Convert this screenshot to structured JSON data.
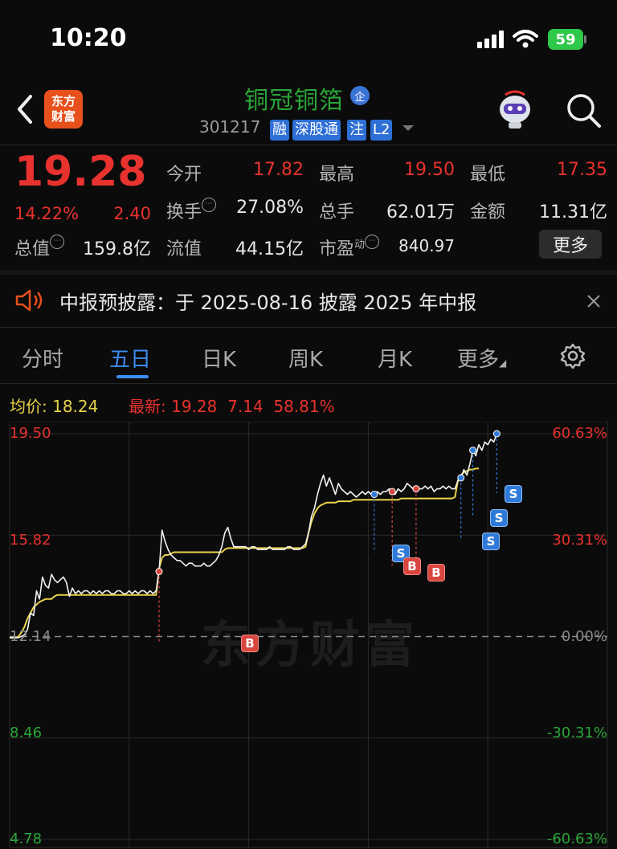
{
  "status_bar": {
    "time": "10:20",
    "battery": "59"
  },
  "header": {
    "logo_line1": "东方",
    "logo_line2": "财富",
    "title": "铜冠铜箔",
    "title_badge": "企",
    "code": "301217",
    "tags": [
      "融",
      "深股通",
      "注",
      "L2"
    ]
  },
  "quote": {
    "price": "19.28",
    "change_pct": "14.22%",
    "change_amt": "2.40",
    "open_label": "今开",
    "open_value": "17.82",
    "high_label": "最高",
    "high_value": "19.50",
    "low_label": "最低",
    "low_value": "17.35",
    "turnover_label": "换手",
    "turnover_value": "27.08%",
    "volume_label": "总手",
    "volume_value": "62.01万",
    "amount_label": "金额",
    "amount_value": "11.31亿",
    "mcap_label": "总值",
    "mcap_value": "159.8亿",
    "float_label": "流值",
    "float_value": "44.15亿",
    "pe_label": "市盈",
    "pe_sup": "动",
    "pe_value": "840.97",
    "more_label": "更多"
  },
  "notice": {
    "text": "中报预披露：于 2025-08-16 披露 2025 年中报"
  },
  "tabs": [
    "分时",
    "五日",
    "日K",
    "周K",
    "月K",
    "更多"
  ],
  "active_tab": "五日",
  "chart_header": {
    "avg_label": "均价:",
    "avg_value": "18.24",
    "latest_label": "最新:",
    "latest_value": "19.28",
    "latest_change": "7.14",
    "latest_pct": "58.81%"
  },
  "watermark": "东方财富",
  "colors": {
    "up": "#e8322e",
    "down": "#2aa637",
    "accent": "#3d8df0",
    "avg_line": "#e8d24a"
  },
  "chart_data": {
    "type": "line",
    "y_left_ticks": [
      "19.50",
      "15.82",
      "12.14",
      "8.46",
      "4.78"
    ],
    "y_right_ticks": [
      "60.63%",
      "30.31%",
      "0.00%",
      "-30.31%",
      "-60.63%"
    ],
    "ylim": [
      4.78,
      19.5
    ],
    "reference_price": 12.14,
    "days": 5,
    "series": [
      {
        "name": "价格",
        "values": [
          12.1,
          12.1,
          12.1,
          12.1,
          12.15,
          12.2,
          12.4,
          13.0,
          12.9,
          13.8,
          13.5,
          14.3,
          14.0,
          13.9,
          14.4,
          14.2,
          14.1,
          14.2,
          14.3,
          14.1,
          13.6,
          13.9,
          13.7,
          13.8,
          13.7,
          13.8,
          13.8,
          13.7,
          13.8,
          13.7,
          13.8,
          13.7,
          13.8,
          13.8,
          13.7,
          13.7,
          13.8,
          13.8,
          13.7,
          13.7,
          13.8,
          13.7,
          13.8,
          13.7,
          13.8,
          13.8,
          13.7,
          13.8,
          13.7,
          13.8,
          14.5,
          16.0,
          15.6,
          15.3,
          15.1,
          15.0,
          14.9,
          14.9,
          14.8,
          14.7,
          14.8,
          14.8,
          14.7,
          14.7,
          14.7,
          14.8,
          14.7,
          14.7,
          14.8,
          14.9,
          15.1,
          15.4,
          15.9,
          16.1,
          15.7,
          15.4,
          15.4,
          15.4,
          15.4,
          15.4,
          15.3,
          15.4,
          15.4,
          15.3,
          15.3,
          15.3,
          15.3,
          15.4,
          15.3,
          15.3,
          15.3,
          15.3,
          15.3,
          15.4,
          15.4,
          15.3,
          15.3,
          15.3,
          15.4,
          15.5,
          15.9,
          16.5,
          16.8,
          17.3,
          17.7,
          18.0,
          17.6,
          17.9,
          17.6,
          17.3,
          17.7,
          17.5,
          17.4,
          17.3,
          17.4,
          17.3,
          17.2,
          17.3,
          17.4,
          17.3,
          17.4,
          17.3,
          17.3,
          17.4,
          17.3,
          17.4,
          17.4,
          17.5,
          17.4,
          17.3,
          17.5,
          17.4,
          17.5,
          17.7,
          17.6,
          17.5,
          17.5,
          17.5,
          17.5,
          17.6,
          17.5,
          17.6,
          17.4,
          17.5,
          17.5,
          17.6,
          17.5,
          17.6,
          17.5,
          17.5,
          17.8,
          17.9,
          18.2,
          18.0,
          18.4,
          18.9,
          18.7,
          19.1,
          18.9,
          19.2,
          19.1,
          19.3,
          19.2,
          19.5
        ]
      },
      {
        "name": "均价",
        "values": [
          12.1,
          12.1,
          12.1,
          12.15,
          12.3,
          12.5,
          12.8,
          13.0,
          13.2,
          13.3,
          13.4,
          13.45,
          13.5,
          13.5,
          13.5,
          13.6,
          13.65,
          13.65,
          13.65,
          13.65,
          13.65,
          13.65,
          13.65,
          13.65,
          13.65,
          13.65,
          13.65,
          13.65,
          13.65,
          13.65,
          13.65,
          13.65,
          13.65,
          13.65,
          13.65,
          13.65,
          13.65,
          13.65,
          13.65,
          13.65,
          13.65,
          13.65,
          13.65,
          13.65,
          13.65,
          13.65,
          13.65,
          13.65,
          13.65,
          13.65,
          14.6,
          15.0,
          15.1,
          15.1,
          15.15,
          15.2,
          15.2,
          15.2,
          15.2,
          15.2,
          15.2,
          15.2,
          15.2,
          15.2,
          15.2,
          15.2,
          15.2,
          15.2,
          15.2,
          15.2,
          15.2,
          15.2,
          15.3,
          15.35,
          15.35,
          15.35,
          15.35,
          15.35,
          15.35,
          15.35,
          15.35,
          15.35,
          15.35,
          15.35,
          15.35,
          15.35,
          15.35,
          15.35,
          15.35,
          15.35,
          15.35,
          15.35,
          15.35,
          15.35,
          15.35,
          15.35,
          15.35,
          15.35,
          15.35,
          15.4,
          15.9,
          16.3,
          16.6,
          16.8,
          16.9,
          16.95,
          17.0,
          17.0,
          17.0,
          17.0,
          17.05,
          17.05,
          17.05,
          17.05,
          17.05,
          17.1,
          17.1,
          17.1,
          17.1,
          17.1,
          17.1,
          17.1,
          17.1,
          17.1,
          17.1,
          17.1,
          17.1,
          17.1,
          17.1,
          17.1,
          17.1,
          17.15,
          17.15,
          17.15,
          17.15,
          17.15,
          17.15,
          17.15,
          17.15,
          17.15,
          17.15,
          17.15,
          17.15,
          17.15,
          17.15,
          17.15,
          17.15,
          17.15,
          17.15,
          17.2,
          17.8,
          18.0,
          18.1,
          18.15,
          18.2,
          18.2,
          18.24,
          18.24
        ]
      }
    ],
    "trade_marks": [
      "B",
      "S",
      "B",
      "B",
      "S",
      "S",
      "S"
    ]
  }
}
